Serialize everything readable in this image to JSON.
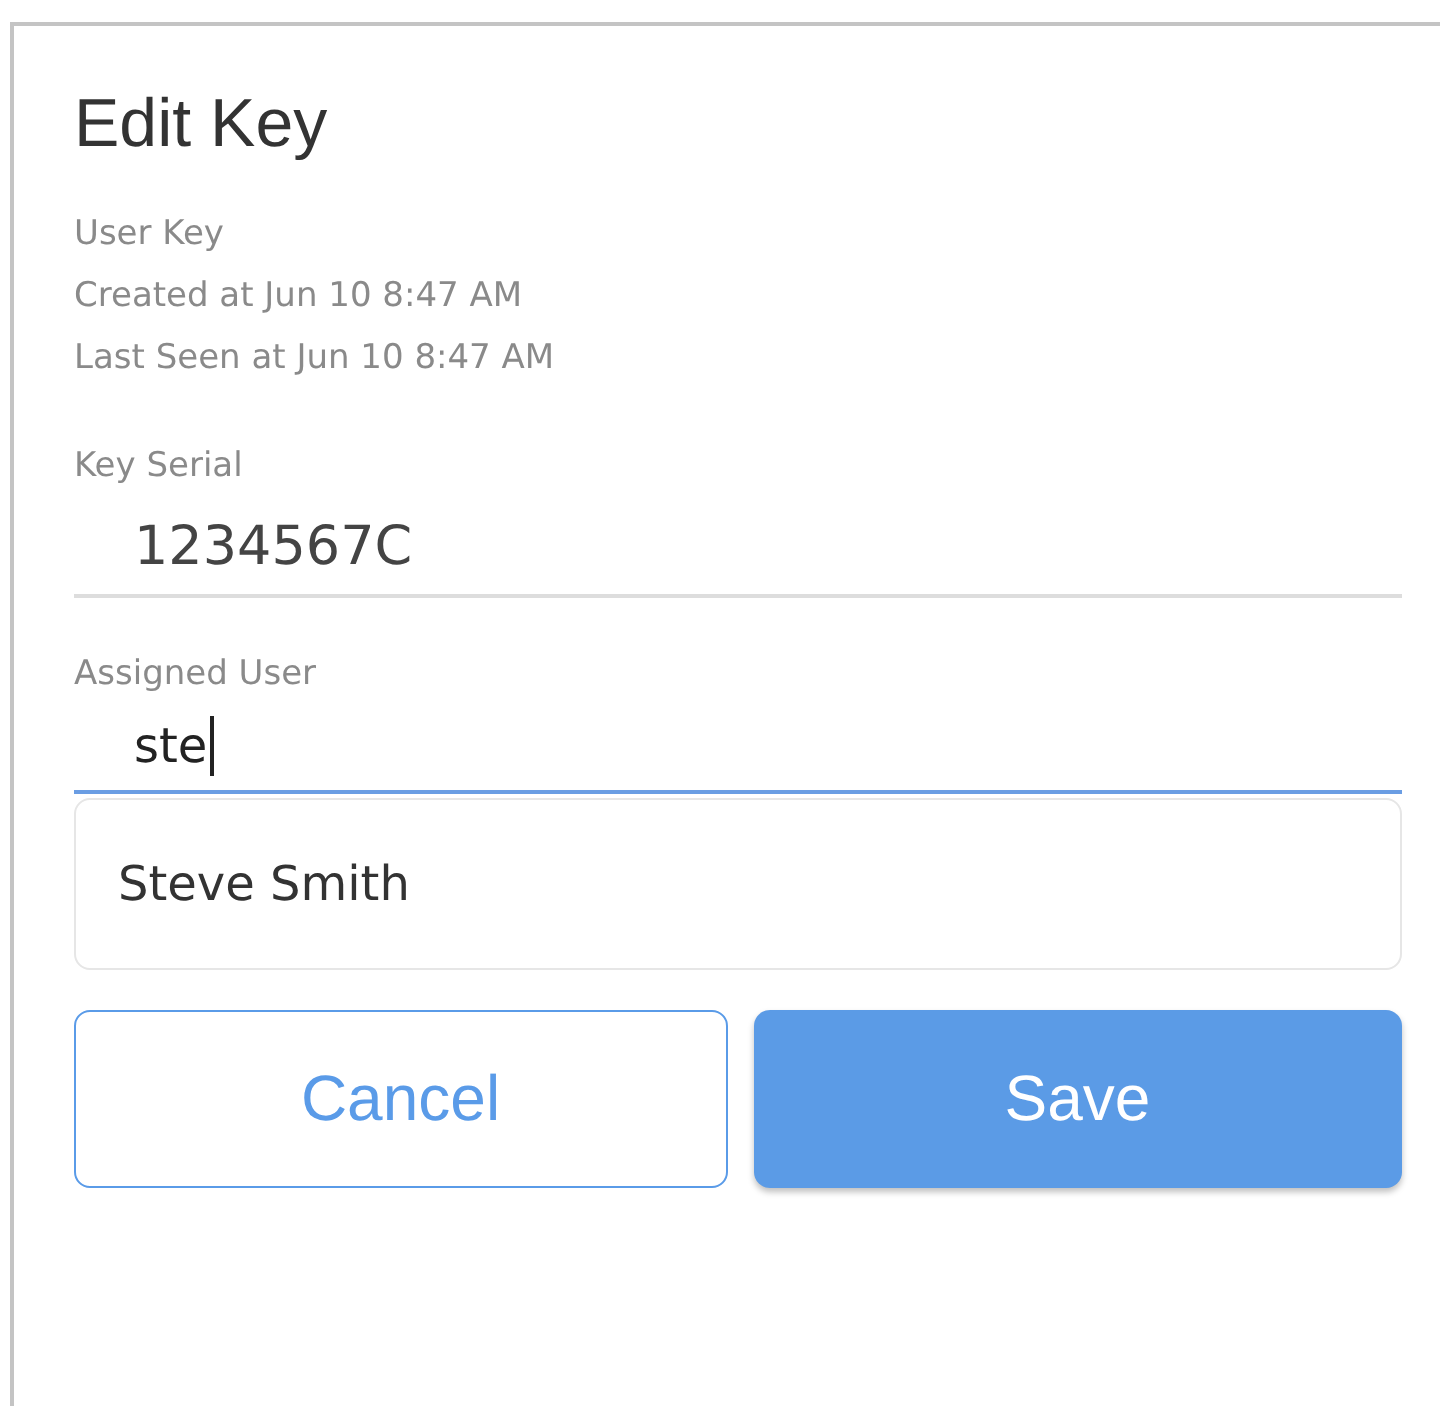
{
  "dialog": {
    "title": "Edit Key"
  },
  "info": [
    "User Key",
    "Created at Jun 10 8:47 AM",
    "Last Seen at Jun 10 8:47 AM"
  ],
  "fields": [
    {
      "label": "Key Serial",
      "value": "1234567C",
      "focused": false
    },
    {
      "label": "Assigned User",
      "value": "ste",
      "focused": true
    }
  ],
  "suggestions": [
    {
      "label": "Steve Smith"
    }
  ],
  "buttons": [
    {
      "label": "Cancel",
      "kind": "secondary"
    },
    {
      "label": "Save",
      "kind": "primary"
    }
  ]
}
